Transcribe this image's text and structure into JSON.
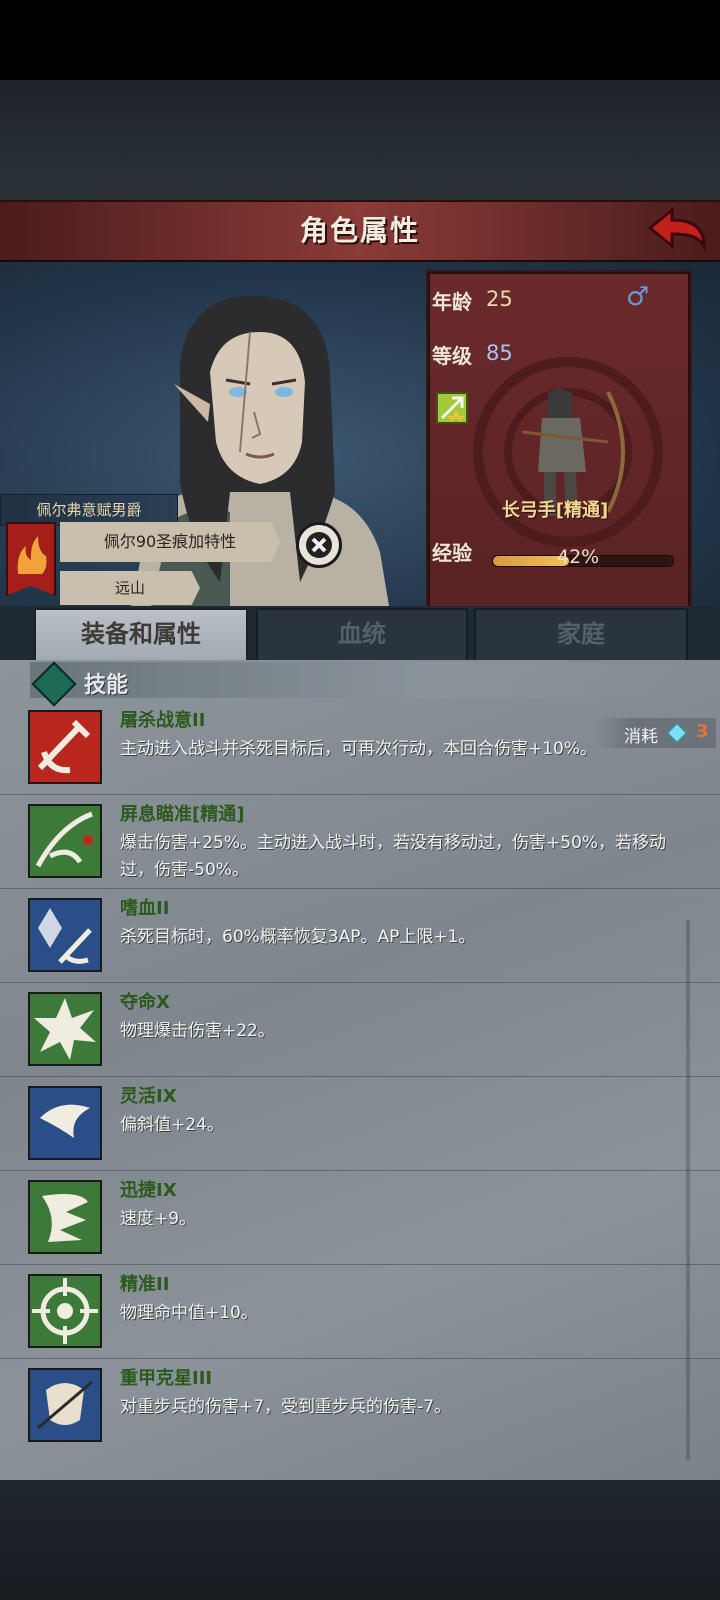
{
  "header": {
    "title": "角色属性"
  },
  "character": {
    "title_banner": "佩尔弗意赋男爵",
    "trait": "佩尔90圣痕加特性",
    "origin": "远山",
    "age_label": "年龄",
    "age": "25",
    "level_label": "等级",
    "level": "85",
    "gender_icon": "♂",
    "class_name": "长弓手[精通]",
    "exp_label": "经验",
    "exp_text": "42%",
    "exp_fraction": 0.42
  },
  "tabs": [
    {
      "label": "装备和属性",
      "active": true
    },
    {
      "label": "血统",
      "active": false
    },
    {
      "label": "家庭",
      "active": false
    }
  ],
  "skills_section": {
    "title": "技能",
    "cost_label": "消耗",
    "cost_value": "3"
  },
  "skills": [
    {
      "name": "屠杀战意II",
      "desc": "主动进入战斗并杀死目标后，可再次行动，本回合伤害+10%。",
      "icon": "bloodlust-slash-icon",
      "bg": "#b8261e"
    },
    {
      "name": "屏息瞄准[精通]",
      "desc": "爆击伤害+25%。主动进入战斗时，若没有移动过，伤害+50%，若移动过，伤害-50%。",
      "icon": "aim-bird-icon",
      "bg": "#3d7a3a"
    },
    {
      "name": "嗜血II",
      "desc": "杀死目标时，60%概率恢复3AP。AP上限+1。",
      "icon": "blood-crystal-icon",
      "bg": "#2a4e88"
    },
    {
      "name": "夺命X",
      "desc": "物理爆击伤害+22。",
      "icon": "burst-star-icon",
      "bg": "#3d7a3a"
    },
    {
      "name": "灵活IX",
      "desc": "偏斜值+24。",
      "icon": "feather-icon",
      "bg": "#2a4e88"
    },
    {
      "name": "迅捷IX",
      "desc": "速度+9。",
      "icon": "wing-icon",
      "bg": "#3d7a3a"
    },
    {
      "name": "精准II",
      "desc": "物理命中值+10。",
      "icon": "crosshair-icon",
      "bg": "#3d7a3a"
    },
    {
      "name": "重甲克星III",
      "desc": "对重步兵的伤害+7，受到重步兵的伤害-7。",
      "icon": "armor-break-icon",
      "bg": "#2a4e88"
    }
  ]
}
